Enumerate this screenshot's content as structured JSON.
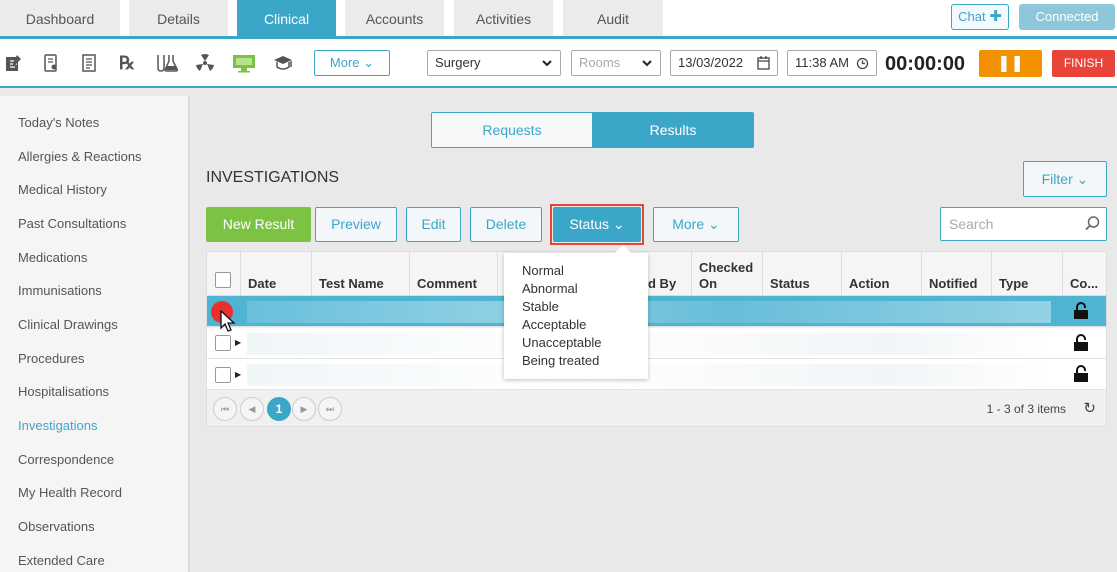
{
  "tabs": [
    {
      "label": "Dashboard",
      "active": false
    },
    {
      "label": "Details",
      "active": false
    },
    {
      "label": "Clinical",
      "active": true
    },
    {
      "label": "Accounts",
      "active": false
    },
    {
      "label": "Activities",
      "active": false
    },
    {
      "label": "Audit",
      "active": false
    }
  ],
  "header": {
    "chat_label": "Chat",
    "connected_label": "Connected"
  },
  "toolbar": {
    "icons": [
      "notes-icon",
      "prescription-pad-icon",
      "form-icon",
      "rx-icon",
      "lab-flask-icon",
      "radiation-icon",
      "monitor-icon",
      "education-icon"
    ],
    "more_label": "More",
    "surgery_value": "Surgery",
    "rooms_placeholder": "Rooms",
    "date_value": "13/03/2022",
    "time_value": "11:38 AM",
    "timer": "00:00:00",
    "finish_label": "FINISH"
  },
  "sidebar": {
    "items": [
      {
        "label": "Today's Notes",
        "active": false
      },
      {
        "label": "Allergies & Reactions",
        "active": false
      },
      {
        "label": "Medical History",
        "active": false
      },
      {
        "label": "Past Consultations",
        "active": false
      },
      {
        "label": "Medications",
        "active": false
      },
      {
        "label": "Immunisations",
        "active": false
      },
      {
        "label": "Clinical Drawings",
        "active": false
      },
      {
        "label": "Procedures",
        "active": false
      },
      {
        "label": "Hospitalisations",
        "active": false
      },
      {
        "label": "Investigations",
        "active": true
      },
      {
        "label": "Correspondence",
        "active": false
      },
      {
        "label": "My Health Record",
        "active": false
      },
      {
        "label": "Observations",
        "active": false
      },
      {
        "label": "Extended Care",
        "active": false
      }
    ]
  },
  "main": {
    "segments": {
      "requests": "Requests",
      "results": "Results"
    },
    "title": "INVESTIGATIONS",
    "filter_label": "Filter",
    "actions": {
      "new_result": "New Result",
      "preview": "Preview",
      "edit": "Edit",
      "delete": "Delete",
      "status": "Status",
      "more": "More"
    },
    "search_placeholder": "Search",
    "columns": [
      "Date",
      "Test Name",
      "Comment",
      "d By",
      "Checked On",
      "Status",
      "Action",
      "Notified",
      "Type",
      "Co..."
    ],
    "rows": [
      {
        "selected": true,
        "locked": true
      },
      {
        "selected": false,
        "locked": true
      },
      {
        "selected": false,
        "locked": true
      }
    ],
    "pager": {
      "current_page": "1",
      "items_text": "1 - 3 of 3 items"
    },
    "status_menu": [
      "Normal",
      "Abnormal",
      "Stable",
      "Acceptable",
      "Unacceptable",
      "Being treated"
    ]
  },
  "colors": {
    "accent": "#3ba7c8",
    "green": "#7cc243",
    "orange": "#f39200",
    "red": "#e8443a"
  }
}
